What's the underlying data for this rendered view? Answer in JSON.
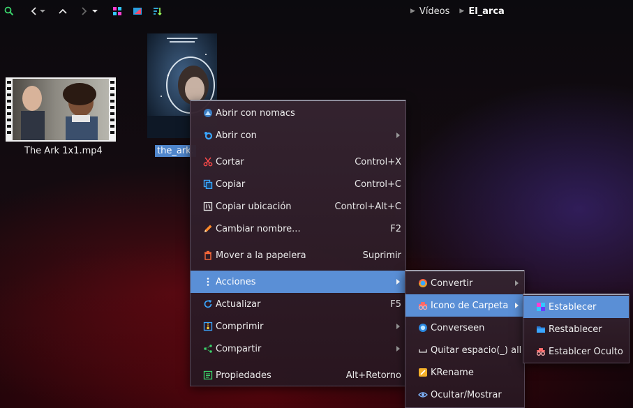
{
  "breadcrumb": {
    "items": [
      "Vídeos",
      "El_arca"
    ]
  },
  "files": [
    {
      "name": "The Ark 1x1.mp4"
    },
    {
      "name": "the_ark."
    }
  ],
  "context_menu": {
    "items": [
      {
        "label": "Abrir con nomacs",
        "shortcut": ""
      },
      {
        "label": "Abrir con",
        "shortcut": ""
      },
      {
        "label": "Cortar",
        "shortcut": "Control+X"
      },
      {
        "label": "Copiar",
        "shortcut": "Control+C"
      },
      {
        "label": "Copiar ubicación",
        "shortcut": "Control+Alt+C"
      },
      {
        "label": "Cambiar nombre...",
        "shortcut": "F2"
      },
      {
        "label": "Mover a la papelera",
        "shortcut": "Suprimir"
      },
      {
        "label": "Acciones",
        "shortcut": ""
      },
      {
        "label": "Actualizar",
        "shortcut": "F5"
      },
      {
        "label": "Comprimir",
        "shortcut": ""
      },
      {
        "label": "Compartir",
        "shortcut": ""
      },
      {
        "label": "Propiedades",
        "shortcut": "Alt+Retorno"
      }
    ]
  },
  "actions_submenu": {
    "items": [
      {
        "label": "Convertir"
      },
      {
        "label": "Icono de Carpeta"
      },
      {
        "label": "Converseen"
      },
      {
        "label": "Quitar espacio(_) all"
      },
      {
        "label": "KRename"
      },
      {
        "label": "Ocultar/Mostrar"
      }
    ]
  },
  "folder_icon_submenu": {
    "items": [
      {
        "label": "Establecer"
      },
      {
        "label": "Restablecer"
      },
      {
        "label": "Establcer Oculto"
      }
    ]
  },
  "colors": {
    "highlight": "#5a8fd6",
    "selection": "#4f86cc"
  }
}
